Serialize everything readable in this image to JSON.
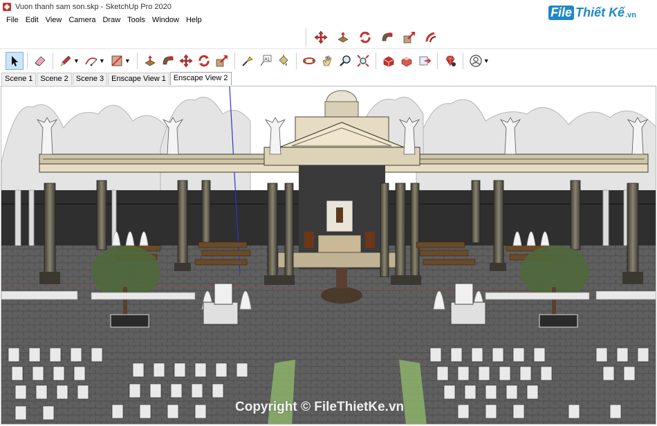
{
  "window": {
    "title": "Vuon thanh sam son.skp - SketchUp Pro 2020"
  },
  "brand": {
    "file": "File",
    "rest": "Thiết Kế",
    "vn": ".vn"
  },
  "menu": [
    "File",
    "Edit",
    "View",
    "Camera",
    "Draw",
    "Tools",
    "Window",
    "Help"
  ],
  "scenes": [
    "Scene 1",
    "Scene 2",
    "Scene 3",
    "Enscape View 1",
    "Enscape View 2"
  ],
  "active_scene": "Enscape View 2",
  "watermark": "Copyright © FileThietKe.vn",
  "colors": {
    "accent_red": "#c8302b",
    "toolbar_bg": "#ffffff",
    "sky": "#ffffff",
    "ground": "#5d5d5d",
    "stone": "#d9ceb2"
  },
  "toolbar_top_icons": [
    "move-red-icon",
    "push-pull-icon",
    "rotate-icon",
    "follow-me-icon",
    "scale-icon",
    "offset-icon"
  ],
  "toolbar_main_icons": [
    "select-arrow-icon",
    "eraser-icon",
    "pencil-line-icon",
    "arc-icon",
    "rectangle-icon",
    "push-pull-icon",
    "follow-me-icon",
    "move-icon",
    "rotate-icon",
    "scale-icon",
    "tape-measure-icon",
    "text-label-icon",
    "paint-bucket-icon",
    "orbit-icon",
    "pan-hand-icon",
    "zoom-icon",
    "zoom-extents-icon",
    "warehouse-icon",
    "extension-warehouse-icon",
    "send-to-layout-icon",
    "ruby-gem-icon",
    "account-icon"
  ]
}
